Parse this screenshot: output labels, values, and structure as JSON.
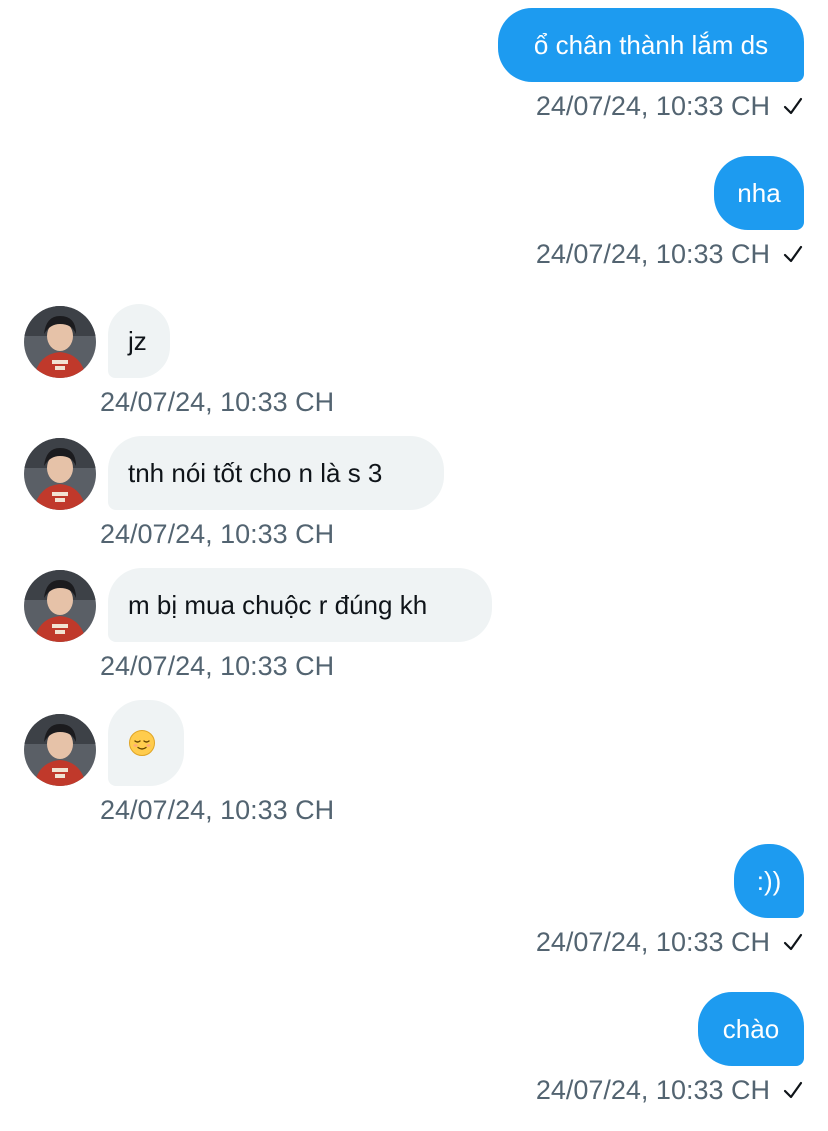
{
  "messages": [
    {
      "direction": "out",
      "text": "ổ chân thành lắm ds",
      "time": "24/07/24, 10:33 CH",
      "status_icon": "check-icon"
    },
    {
      "direction": "out",
      "text": "nha",
      "time": "24/07/24, 10:33 CH",
      "status_icon": "check-icon"
    },
    {
      "direction": "in",
      "text": "jz",
      "time": "24/07/24, 10:33 CH"
    },
    {
      "direction": "in",
      "text": "tnh nói tốt cho n là s 3",
      "time": "24/07/24, 10:33 CH"
    },
    {
      "direction": "in",
      "text": "m bị mua chuộc r đúng kh",
      "time": "24/07/24, 10:33 CH"
    },
    {
      "direction": "in",
      "text": "",
      "emoji": "relieved-face-emoji",
      "time": "24/07/24, 10:33 CH"
    },
    {
      "direction": "out",
      "text": ":))",
      "time": "24/07/24, 10:33 CH",
      "status_icon": "check-icon"
    },
    {
      "direction": "out",
      "text": "chào",
      "time": "24/07/24, 10:33 CH",
      "status_icon": "check-icon"
    }
  ],
  "colors": {
    "outgoing_bubble": "#1d9bf0",
    "incoming_bubble": "#eff3f4",
    "timestamp": "#536471",
    "avatar_hoodie": "#c0392b"
  }
}
